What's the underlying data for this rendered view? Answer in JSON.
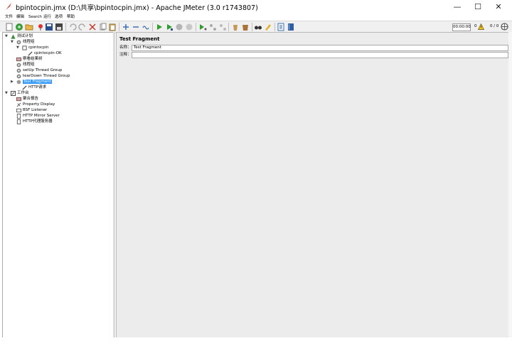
{
  "window": {
    "title": "bpintocpin.jmx (D:\\共享\\bpintocpin.jmx) - Apache JMeter (3.0 r1743807)",
    "minimize_glyph": "—",
    "maximize_glyph": "☐",
    "close_glyph": "✕"
  },
  "menu": [
    "文件",
    "编辑",
    "Search",
    "运行",
    "选项",
    "帮助"
  ],
  "toolbar": {
    "timer": "00:00:00",
    "warnings": "0",
    "threads": "0 / 0"
  },
  "tree": {
    "items": [
      {
        "label": "测试计划",
        "icon": "test-plan-icon"
      },
      {
        "label": "线程组",
        "icon": "thread-group-icon"
      },
      {
        "label": "cpintocpin",
        "icon": "controller-icon"
      },
      {
        "label": "cpintocpin-OK",
        "icon": "sampler-icon"
      },
      {
        "label": "察看结果树",
        "icon": "listener-icon"
      },
      {
        "label": "线程组",
        "icon": "thread-group-icon"
      },
      {
        "label": "setUp Thread Group",
        "icon": "thread-group-icon"
      },
      {
        "label": "tearDown Thread Group",
        "icon": "thread-group-icon"
      },
      {
        "label": "Test Fragment",
        "icon": "fragment-icon"
      },
      {
        "label": "HTTP请求",
        "icon": "sampler-icon"
      },
      {
        "label": "工作台",
        "icon": "workbench-icon"
      },
      {
        "label": "聚合报告",
        "icon": "listener-icon"
      },
      {
        "label": "Property Display",
        "icon": "property-icon"
      },
      {
        "label": "BSF Listener",
        "icon": "listener-icon"
      },
      {
        "label": "HTTP Mirror Server",
        "icon": "server-icon"
      },
      {
        "label": "HTTP代理服务器",
        "icon": "proxy-icon"
      }
    ]
  },
  "panel": {
    "heading": "Test Fragment",
    "name_label": "名称：",
    "name_value": "Test Fragment",
    "comment_label": "注释：",
    "comment_value": ""
  },
  "colors": {
    "selection": "#3399ff",
    "toolbar_bg": "#f0f0f0",
    "panel_bg": "#ececec"
  }
}
